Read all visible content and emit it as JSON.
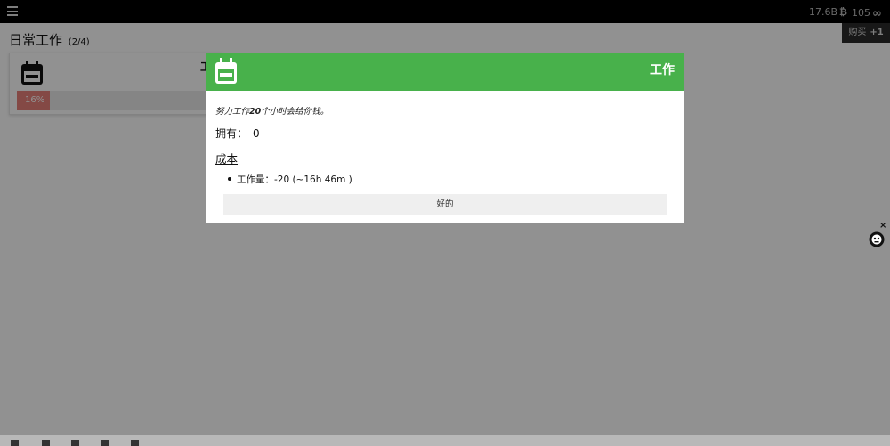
{
  "topbar": {
    "menu_icon": "hamburger-menu-icon",
    "btc_value": "17.6B",
    "btc_icon": "bitcoin-icon",
    "infinity_value": "105",
    "infinity_icon": "infinity-icon"
  },
  "buy": {
    "label": "购买",
    "amount": "+1"
  },
  "page": {
    "title": "日常工作",
    "count": "(2/4)"
  },
  "card": {
    "icon": "calendar-icon",
    "label": "工",
    "progress_text": "16%",
    "progress": 0.16
  },
  "modal": {
    "title": "工作",
    "icon": "calendar-icon",
    "desc_prefix": "努力工作",
    "desc_hours": "20",
    "desc_suffix": "个小时会给你钱。",
    "owned_label": "拥有：",
    "owned_value": "0",
    "cost_heading": "成本",
    "cost_item": "工作量：-20 (~16h 46m )",
    "ok_label": "好的"
  },
  "widget": {
    "close_icon": "close-icon",
    "robot_icon": "robot-icon",
    "close_glyph": "×"
  },
  "colors": {
    "accent": "#48b14b",
    "progress": "#e8817a",
    "topbar": "#000000"
  }
}
